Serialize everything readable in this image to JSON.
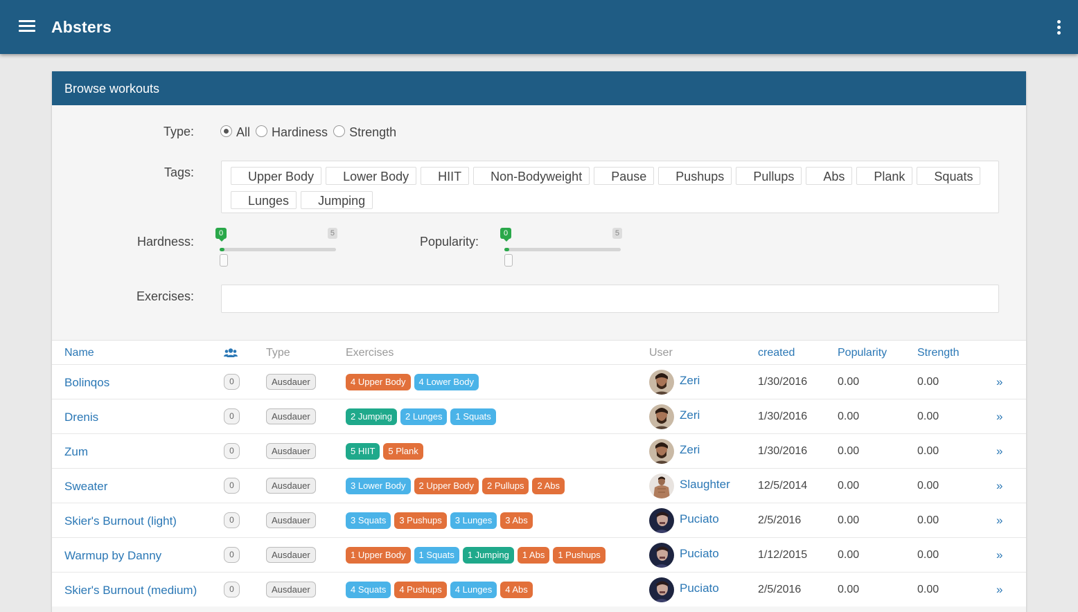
{
  "app": {
    "title": "Absters"
  },
  "panel": {
    "title": "Browse workouts"
  },
  "filters": {
    "type_label": "Type:",
    "type_options": [
      {
        "label": "All",
        "checked": true
      },
      {
        "label": "Hardiness",
        "checked": false
      },
      {
        "label": "Strength",
        "checked": false
      }
    ],
    "tags_label": "Tags:",
    "tags": [
      "Upper Body",
      "Lower Body",
      "HIIT",
      "Non-Bodyweight",
      "Pause",
      "Pushups",
      "Pullups",
      "Abs",
      "Plank",
      "Squats",
      "Lunges",
      "Jumping"
    ],
    "hardness_label": "Hardness:",
    "hardness": {
      "min": "0",
      "max": "5",
      "value": 0
    },
    "popularity_label": "Popularity:",
    "popularity": {
      "min": "0",
      "max": "5",
      "value": 0
    },
    "exercises_label": "Exercises:",
    "exercises_value": ""
  },
  "table": {
    "columns": {
      "name": "Name",
      "type": "Type",
      "exercises": "Exercises",
      "user": "User",
      "created": "created",
      "popularity": "Popularity",
      "strength": "Strength"
    },
    "rows": [
      {
        "name": "Bolinqos",
        "count": "0",
        "type": "Ausdauer",
        "exercises": [
          {
            "label": "4 Upper Body",
            "color": "#e2703a"
          },
          {
            "label": "4 Lower Body",
            "color": "#4ab3e8"
          }
        ],
        "user": "Zeri",
        "avatar": "zeri",
        "created": "1/30/2016",
        "popularity": "0.00",
        "strength": "0.00",
        "more": "»"
      },
      {
        "name": "Drenis",
        "count": "0",
        "type": "Ausdauer",
        "exercises": [
          {
            "label": "2 Jumping",
            "color": "#1fa98b"
          },
          {
            "label": "2 Lunges",
            "color": "#4ab3e8"
          },
          {
            "label": "1 Squats",
            "color": "#4ab3e8"
          }
        ],
        "user": "Zeri",
        "avatar": "zeri",
        "created": "1/30/2016",
        "popularity": "0.00",
        "strength": "0.00",
        "more": "»"
      },
      {
        "name": "Zum",
        "count": "0",
        "type": "Ausdauer",
        "exercises": [
          {
            "label": "5 HIIT",
            "color": "#1fa98b"
          },
          {
            "label": "5 Plank",
            "color": "#e2703a"
          }
        ],
        "user": "Zeri",
        "avatar": "zeri",
        "created": "1/30/2016",
        "popularity": "0.00",
        "strength": "0.00",
        "more": "»"
      },
      {
        "name": "Sweater",
        "count": "0",
        "type": "Ausdauer",
        "exercises": [
          {
            "label": "3 Lower Body",
            "color": "#4ab3e8"
          },
          {
            "label": "2 Upper Body",
            "color": "#e2703a"
          },
          {
            "label": "2 Pullups",
            "color": "#e2703a"
          },
          {
            "label": "2 Abs",
            "color": "#e2703a"
          }
        ],
        "user": "Slaughter",
        "avatar": "slaughter",
        "created": "12/5/2014",
        "popularity": "0.00",
        "strength": "0.00",
        "more": "»"
      },
      {
        "name": "Skier's Burnout (light)",
        "count": "0",
        "type": "Ausdauer",
        "exercises": [
          {
            "label": "3 Squats",
            "color": "#4ab3e8"
          },
          {
            "label": "3 Pushups",
            "color": "#e2703a"
          },
          {
            "label": "3 Lunges",
            "color": "#4ab3e8"
          },
          {
            "label": "3 Abs",
            "color": "#e2703a"
          }
        ],
        "user": "Puciato",
        "avatar": "puciato",
        "created": "2/5/2016",
        "popularity": "0.00",
        "strength": "0.00",
        "more": "»"
      },
      {
        "name": "Warmup by Danny",
        "count": "0",
        "type": "Ausdauer",
        "exercises": [
          {
            "label": "1 Upper Body",
            "color": "#e2703a"
          },
          {
            "label": "1 Squats",
            "color": "#4ab3e8"
          },
          {
            "label": "1 Jumping",
            "color": "#1fa98b"
          },
          {
            "label": "1 Abs",
            "color": "#e2703a"
          },
          {
            "label": "1 Pushups",
            "color": "#e2703a"
          }
        ],
        "user": "Puciato",
        "avatar": "puciato",
        "created": "1/12/2015",
        "popularity": "0.00",
        "strength": "0.00",
        "more": "»"
      },
      {
        "name": "Skier's Burnout (medium)",
        "count": "0",
        "type": "Ausdauer",
        "exercises": [
          {
            "label": "4 Squats",
            "color": "#4ab3e8"
          },
          {
            "label": "4 Pushups",
            "color": "#e2703a"
          },
          {
            "label": "4 Lunges",
            "color": "#4ab3e8"
          },
          {
            "label": "4 Abs",
            "color": "#e2703a"
          }
        ],
        "user": "Puciato",
        "avatar": "puciato",
        "created": "2/5/2016",
        "popularity": "0.00",
        "strength": "0.00",
        "more": "»"
      }
    ]
  },
  "colors": {
    "primary": "#1f5c84",
    "link": "#2a77b5",
    "success": "#2aa84a"
  }
}
